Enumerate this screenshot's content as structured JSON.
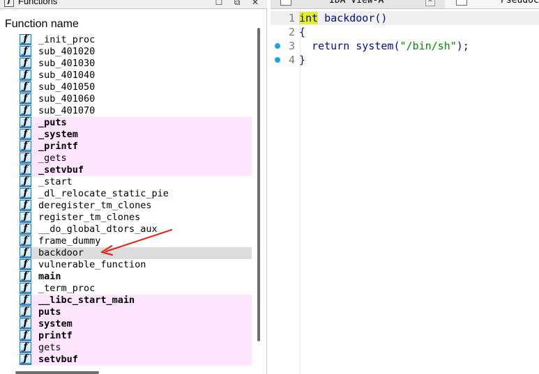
{
  "functions_panel": {
    "title": "Functions",
    "column_header": "Function name",
    "items": [
      {
        "name": "_init_proc",
        "lib": false,
        "bold": false,
        "selected": false
      },
      {
        "name": "sub_401020",
        "lib": false,
        "bold": false,
        "selected": false
      },
      {
        "name": "sub_401030",
        "lib": false,
        "bold": false,
        "selected": false
      },
      {
        "name": "sub_401040",
        "lib": false,
        "bold": false,
        "selected": false
      },
      {
        "name": "sub_401050",
        "lib": false,
        "bold": false,
        "selected": false
      },
      {
        "name": "sub_401060",
        "lib": false,
        "bold": false,
        "selected": false
      },
      {
        "name": "sub_401070",
        "lib": false,
        "bold": false,
        "selected": false
      },
      {
        "name": "_puts",
        "lib": true,
        "bold": true,
        "selected": false
      },
      {
        "name": "_system",
        "lib": true,
        "bold": true,
        "selected": false
      },
      {
        "name": "_printf",
        "lib": true,
        "bold": true,
        "selected": false
      },
      {
        "name": "_gets",
        "lib": true,
        "bold": false,
        "selected": false
      },
      {
        "name": "_setvbuf",
        "lib": true,
        "bold": true,
        "selected": false
      },
      {
        "name": "_start",
        "lib": false,
        "bold": false,
        "selected": false
      },
      {
        "name": "_dl_relocate_static_pie",
        "lib": false,
        "bold": false,
        "selected": false
      },
      {
        "name": "deregister_tm_clones",
        "lib": false,
        "bold": false,
        "selected": false
      },
      {
        "name": "register_tm_clones",
        "lib": false,
        "bold": false,
        "selected": false
      },
      {
        "name": "__do_global_dtors_aux",
        "lib": false,
        "bold": false,
        "selected": false
      },
      {
        "name": "frame_dummy",
        "lib": false,
        "bold": false,
        "selected": false
      },
      {
        "name": "backdoor",
        "lib": false,
        "bold": false,
        "selected": true
      },
      {
        "name": "vulnerable_function",
        "lib": false,
        "bold": false,
        "selected": false
      },
      {
        "name": "main",
        "lib": false,
        "bold": true,
        "selected": false
      },
      {
        "name": "_term_proc",
        "lib": false,
        "bold": false,
        "selected": false
      },
      {
        "name": "__libc_start_main",
        "lib": true,
        "bold": true,
        "selected": false
      },
      {
        "name": "puts",
        "lib": true,
        "bold": true,
        "selected": false
      },
      {
        "name": "system",
        "lib": true,
        "bold": true,
        "selected": false
      },
      {
        "name": "printf",
        "lib": true,
        "bold": true,
        "selected": false
      },
      {
        "name": "gets",
        "lib": true,
        "bold": false,
        "selected": false
      },
      {
        "name": "setvbuf",
        "lib": true,
        "bold": true,
        "selected": false
      }
    ]
  },
  "tabs": [
    {
      "label": "IDA View-A",
      "active": false,
      "close": "✕"
    },
    {
      "label": "Pseudocode-A",
      "active": true
    }
  ],
  "pseudocode": {
    "lines": [
      {
        "num": "1",
        "breakpoint": false,
        "current": true,
        "tokens": [
          {
            "t": "int",
            "c": "kw-hl"
          },
          {
            "t": " backdoor",
            "c": "fnref"
          },
          {
            "t": "()",
            "c": "punct"
          }
        ]
      },
      {
        "num": "2",
        "breakpoint": false,
        "current": false,
        "tokens": [
          {
            "t": "{",
            "c": "punct"
          }
        ]
      },
      {
        "num": "3",
        "breakpoint": true,
        "current": false,
        "tokens": [
          {
            "t": "  return ",
            "c": "kw"
          },
          {
            "t": "system",
            "c": "fnref"
          },
          {
            "t": "(",
            "c": "punct"
          },
          {
            "t": "\"/bin/sh\"",
            "c": "str"
          },
          {
            "t": ");",
            "c": "punct"
          }
        ]
      },
      {
        "num": "4",
        "breakpoint": true,
        "current": false,
        "tokens": [
          {
            "t": "}",
            "c": "punct"
          }
        ]
      }
    ]
  },
  "colors": {
    "lib_row_bg": "#fde6fd",
    "selected_row_bg": "#dcdcdc",
    "annotation_arrow": "#e0281e",
    "breakpoint_dot": "#1fa3e0",
    "keyword_highlight": "#e6f02a"
  }
}
